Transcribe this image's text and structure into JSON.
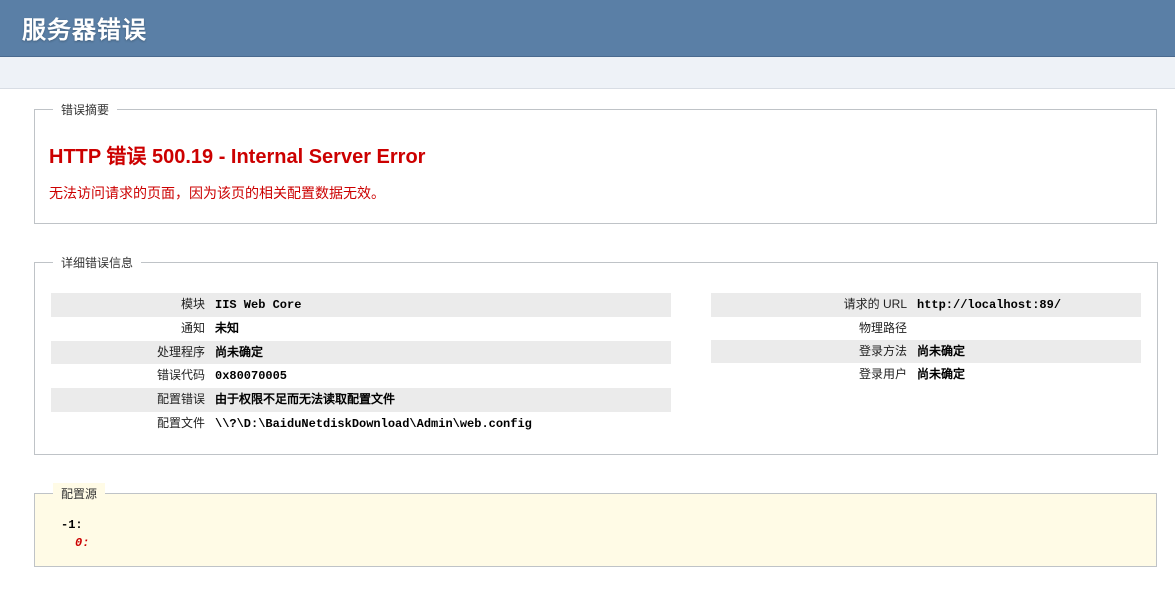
{
  "header": {
    "title": "服务器错误"
  },
  "summary": {
    "legend": "错误摘要",
    "title": "HTTP 错误 500.19 - Internal Server Error",
    "subtitle": "无法访问请求的页面，因为该页的相关配置数据无效。"
  },
  "details": {
    "legend": "详细错误信息",
    "left": [
      {
        "key": "模块",
        "val": "IIS Web Core"
      },
      {
        "key": "通知",
        "val": "未知"
      },
      {
        "key": "处理程序",
        "val": "尚未确定"
      },
      {
        "key": "错误代码",
        "val": "0x80070005"
      },
      {
        "key": "配置错误",
        "val": "由于权限不足而无法读取配置文件"
      },
      {
        "key": "配置文件",
        "val": "\\\\?\\D:\\BaiduNetdiskDownload\\Admin\\web.config"
      }
    ],
    "right": [
      {
        "key": "请求的 URL",
        "val": "http://localhost:89/"
      },
      {
        "key": "物理路径",
        "val": ""
      },
      {
        "key": "登录方法",
        "val": "尚未确定"
      },
      {
        "key": "登录用户",
        "val": "尚未确定"
      }
    ]
  },
  "config_source": {
    "legend": "配置源",
    "line1": "-1:",
    "line2": "0:"
  }
}
